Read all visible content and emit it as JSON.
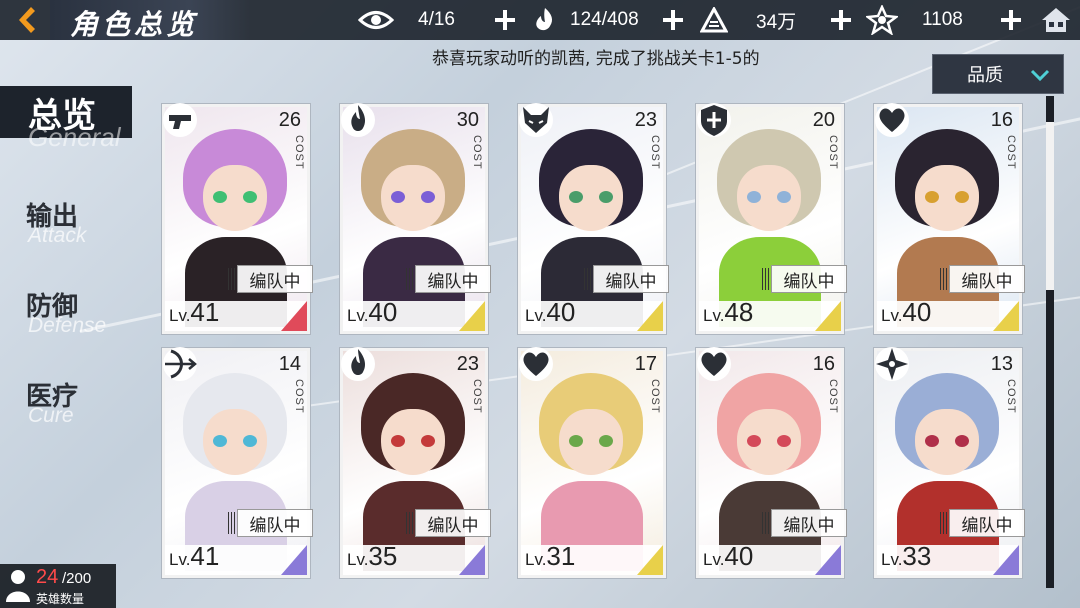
{
  "header": {
    "title": "角色总览",
    "resources": [
      {
        "icon": "eye-icon",
        "value": "4/16"
      },
      {
        "icon": "stamina-icon",
        "value": "124/408"
      },
      {
        "icon": "coin-icon",
        "value": "34万"
      },
      {
        "icon": "star-gem-icon",
        "value": "1108"
      }
    ]
  },
  "notice": "恭喜玩家动听的凯茜, 完成了挑战关卡1-5的",
  "sort": {
    "label": "品质"
  },
  "sidebar": {
    "active": {
      "zh": "总览",
      "en": "General"
    },
    "items": [
      {
        "zh": "输出",
        "en": "Attack"
      },
      {
        "zh": "防御",
        "en": "Defense"
      },
      {
        "zh": "医疗",
        "en": "Cure"
      }
    ]
  },
  "card_labels": {
    "cost": "COST",
    "team": "编队中",
    "lv": "Lv."
  },
  "cards": [
    {
      "cost": "26",
      "level": "41",
      "cls": "gun",
      "hair": "#c88ad8",
      "bg": "#efe6ee",
      "body": "#2a2226",
      "eye": "#3fbf73",
      "tri": "#e04a5a"
    },
    {
      "cost": "30",
      "level": "40",
      "cls": "flame",
      "hair": "#c9ad86",
      "bg": "#e8e0ec",
      "body": "#3a2a44",
      "eye": "#7b5fd6",
      "tri": "#e8d04a"
    },
    {
      "cost": "23",
      "level": "40",
      "cls": "fox",
      "hair": "#2a2438",
      "bg": "#eef0f6",
      "body": "#2c2a36",
      "eye": "#4a9d6a",
      "tri": "#e8d04a"
    },
    {
      "cost": "20",
      "level": "48",
      "cls": "shield",
      "hair": "#cfc8b0",
      "bg": "#f2f2ec",
      "body": "#8ccf3a",
      "eye": "#8fb2d8",
      "tri": "#e8d04a"
    },
    {
      "cost": "16",
      "level": "40",
      "cls": "heart",
      "hair": "#2a2430",
      "bg": "#dbe6f2",
      "body": "#b27a50",
      "eye": "#d8a030",
      "tri": "#e8d04a"
    },
    {
      "cost": "14",
      "level": "41",
      "cls": "bow",
      "hair": "#e6e8ee",
      "bg": "#f0f0f4",
      "body": "#d9d0e6",
      "eye": "#4fb8d6",
      "tri": "#8a7ad8"
    },
    {
      "cost": "23",
      "level": "35",
      "cls": "flame",
      "hair": "#4a2826",
      "bg": "#ecdedc",
      "body": "#5a2c2c",
      "eye": "#c43a3a",
      "tri": "#8a7ad8"
    },
    {
      "cost": "17",
      "level": "31",
      "cls": "heart",
      "hair": "#e8cc78",
      "bg": "#f4ecde",
      "body": "#e89ab0",
      "eye": "#6aa84a",
      "tri": "#e8d04a"
    },
    {
      "cost": "16",
      "level": "40",
      "cls": "heart",
      "hair": "#f0a4a4",
      "bg": "#f2e8ea",
      "body": "#4a3a36",
      "eye": "#d44a5a",
      "tri": "#8a7ad8"
    },
    {
      "cost": "13",
      "level": "33",
      "cls": "shuriken",
      "hair": "#9aaed6",
      "bg": "#eceef2",
      "body": "#b2302c",
      "eye": "#b0304a",
      "tri": "#8a7ad8"
    }
  ],
  "hero_count": {
    "current": "24",
    "max": "/200",
    "label": "英雄数量"
  }
}
